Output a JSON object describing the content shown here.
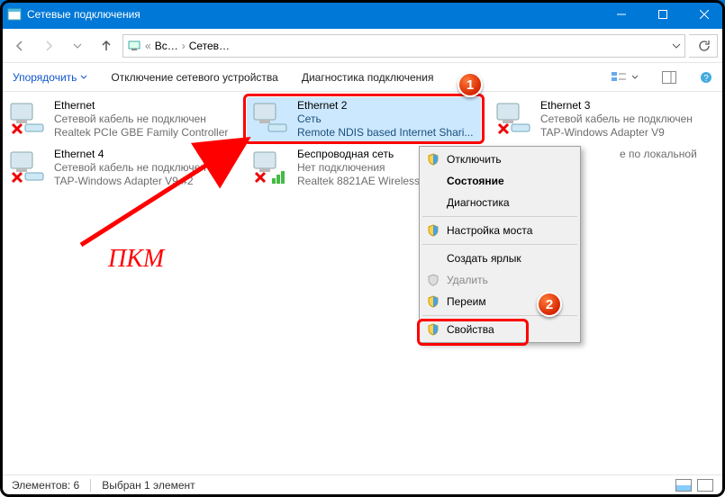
{
  "title": "Сетевые подключения",
  "breadcrumb": {
    "p1": "Вс…",
    "p2": "Сетев…"
  },
  "toolbar": {
    "organize": "Упорядочить",
    "disable": "Отключение сетевого устройства",
    "diag": "Диагностика подключения"
  },
  "connections": [
    {
      "name": "Ethernet",
      "l2": "Сетевой кабель не подключен",
      "l3": "Realtek PCIe GBE Family Controller",
      "state": "x"
    },
    {
      "name": "Ethernet 2",
      "l2": "Сеть",
      "l3": "Remote NDIS based Internet Shari...",
      "state": "ok"
    },
    {
      "name": "Ethernet 3",
      "l2": "Сетевой кабель не подключен",
      "l3": "TAP-Windows Adapter V9",
      "state": "x"
    },
    {
      "name": "Ethernet 4",
      "l2": "Сетевой кабель не подключен",
      "l3": "TAP-Windows Adapter V9 #2",
      "state": "x"
    },
    {
      "name": "Беспроводная сеть",
      "l2": "Нет подключения",
      "l3": "Realtek 8821AE Wireless",
      "state": "wx"
    },
    {
      "name": "",
      "l2": "е по локальной",
      "l3": "",
      "state": "hidden"
    }
  ],
  "context_menu": {
    "disable": "Отключить",
    "status": "Состояние",
    "diag": "Диагностика",
    "bridge": "Настройка моста",
    "shortcut": "Создать ярлык",
    "delete": "Удалить",
    "rename": "Переим",
    "props": "Свойства"
  },
  "annot": {
    "rmb": "ПКМ"
  },
  "badges": {
    "one": "1",
    "two": "2"
  },
  "status": {
    "count": "Элементов: 6",
    "selected": "Выбран 1 элемент"
  }
}
